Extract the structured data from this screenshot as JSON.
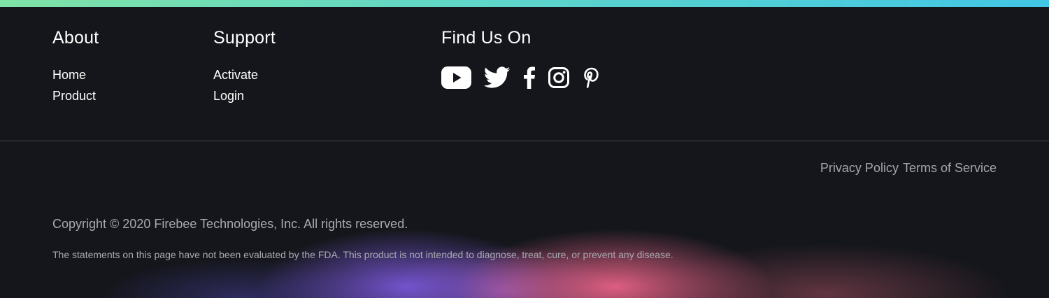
{
  "colors": {
    "background": "#14161b",
    "top_bar_gradient": [
      "#7fe3a6",
      "#41c6e6"
    ],
    "glow_pink": "#e86287",
    "glow_purple": "#7856d6"
  },
  "about": {
    "title": "About",
    "links": [
      "Home",
      "Product"
    ]
  },
  "support": {
    "title": "Support",
    "links": [
      "Activate",
      "Login"
    ]
  },
  "find_us": {
    "title": "Find Us On",
    "icons": [
      "youtube-icon",
      "twitter-icon",
      "facebook-icon",
      "instagram-icon",
      "pinterest-icon"
    ]
  },
  "legal": {
    "privacy": "Privacy Policy",
    "terms": "Terms of Service"
  },
  "copyright": "Copyright © 2020 Firebee Technologies, Inc. All rights reserved.",
  "disclaimer": "The statements on this page have not been evaluated by the FDA. This product is not intended to diagnose, treat, cure, or prevent any disease."
}
